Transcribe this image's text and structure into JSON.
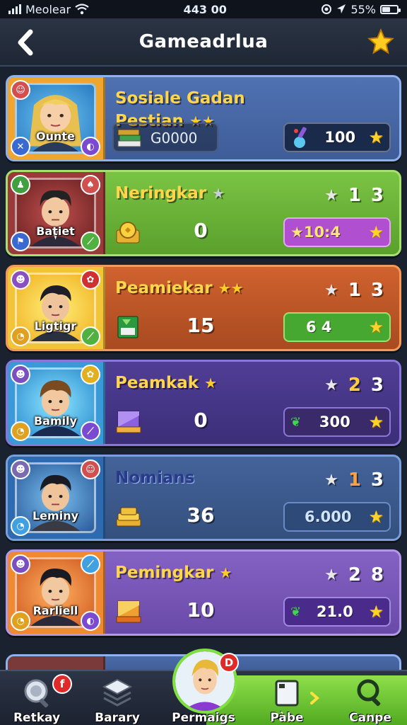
{
  "status_bar": {
    "carrier": "Meolear",
    "time": "443 00",
    "battery": "55%",
    "battery_level": 0.55
  },
  "header": {
    "title": "Gameadrlua",
    "back_icon": "chevron-left-icon",
    "star_icon": "star-icon"
  },
  "rows": [
    {
      "character": "Ounte",
      "name": "Sosiale Gadan Pestian",
      "name_stars": "★★",
      "resource_value": "G0000",
      "score": "100",
      "theme": "blue",
      "colors": {
        "bg": "#4a6aa8",
        "border": "#8fb2ec",
        "portrait": "#f0a52e"
      }
    },
    {
      "character": "Batiet",
      "name": "Neringkar",
      "name_stars": "★",
      "rank_left": "1",
      "rank_right": "3",
      "resource_value": "0",
      "score": "★10:4",
      "theme": "green",
      "colors": {
        "bg": "#6fb83a",
        "border": "#a6e070",
        "portrait": "#9a3a3a"
      }
    },
    {
      "character": "Ligtigr",
      "name": "Peamiekar",
      "name_stars": "★★",
      "rank_left": "1",
      "rank_right": "3",
      "resource_value": "15",
      "score": "6   4",
      "theme": "orange",
      "colors": {
        "bg": "#c85a2a",
        "border": "#f39a5a",
        "portrait": "#f2c438"
      }
    },
    {
      "character": "Bamily",
      "name": "Peamkak",
      "name_stars": "★",
      "rank_left": "2",
      "rank_right": "3",
      "resource_value": "0",
      "score": "300",
      "theme": "purple",
      "colors": {
        "bg": "#4a3a8a",
        "border": "#8a76d8",
        "portrait": "#3a9ad8"
      }
    },
    {
      "character": "Leminy",
      "name": "Nomians",
      "name_stars": "",
      "rank_left": "1",
      "rank_right": "3",
      "resource_value": "36",
      "score": "6.000",
      "theme": "steel",
      "colors": {
        "bg": "#3e5a8e",
        "border": "#7aa0dc",
        "portrait": "#2e6ab0"
      }
    },
    {
      "character": "Rarliell",
      "name": "Pemingkar",
      "name_stars": "★",
      "rank_left": "2",
      "rank_right": "8",
      "resource_value": "10",
      "score": "21.0",
      "theme": "lavender",
      "colors": {
        "bg": "#7a5ab8",
        "border": "#b09ae8",
        "portrait": "#f08a30"
      }
    }
  ],
  "bottom_nav": {
    "items": [
      {
        "label": "Retkay",
        "icon": "search-magnifier-icon"
      },
      {
        "label": "Barary",
        "icon": "stack-icon"
      },
      {
        "label": "Permaigs",
        "icon": "character-portrait-icon"
      },
      {
        "label": "Pàbe",
        "icon": "page-icon"
      },
      {
        "label": "Canpe",
        "icon": "search-icon"
      }
    ],
    "left_badge": "f",
    "center_badge": "D"
  }
}
